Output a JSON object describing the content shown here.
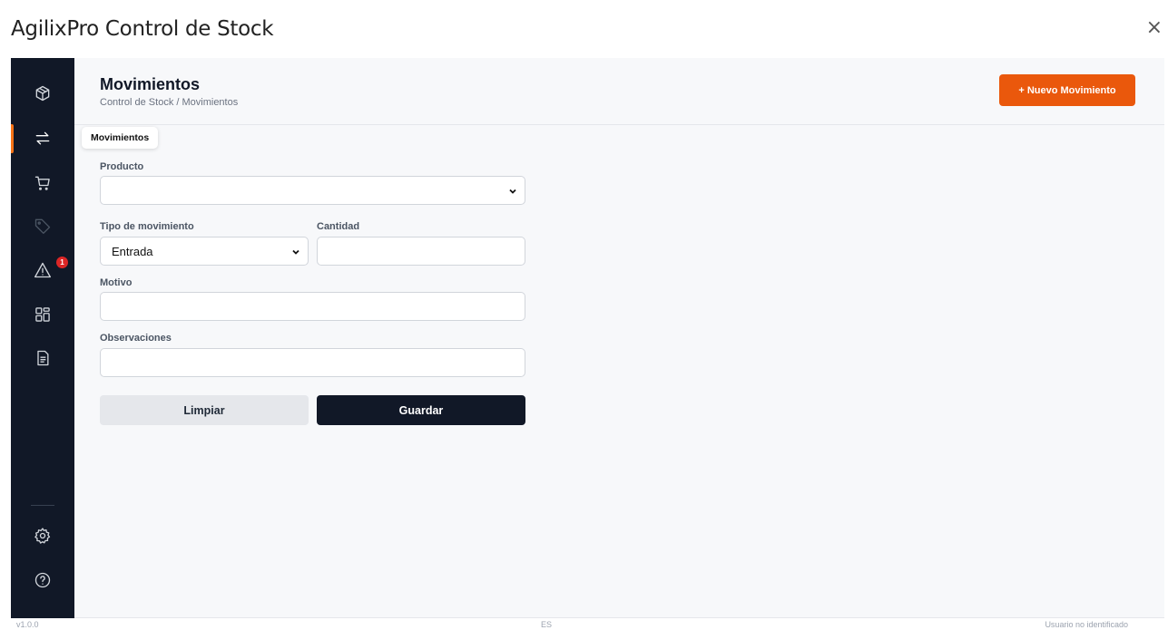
{
  "window": {
    "title": "AgilixPro Control de Stock",
    "close_glyph": "×"
  },
  "sidebar": {
    "items": [
      {
        "icon": "box-icon",
        "name": "products",
        "active": false
      },
      {
        "icon": "transfer-icon",
        "name": "movements",
        "active": true
      },
      {
        "icon": "cart-icon",
        "name": "purchases",
        "active": false
      },
      {
        "icon": "tag-icon",
        "name": "prices",
        "active": false
      },
      {
        "icon": "warning-icon",
        "name": "alerts",
        "active": false,
        "badge": "1"
      },
      {
        "icon": "dashboard-icon",
        "name": "dashboard",
        "active": false
      },
      {
        "icon": "report-icon",
        "name": "reports",
        "active": false
      },
      {
        "icon": "gear-icon",
        "name": "settings",
        "active": false
      },
      {
        "icon": "help-icon",
        "name": "help",
        "active": false
      }
    ],
    "tooltip": "Movimientos"
  },
  "header": {
    "title": "Movimientos",
    "breadcrumb": "Control de Stock / Movimientos",
    "new_button": "+ Nuevo Movimiento"
  },
  "form": {
    "producto_label": "Producto",
    "producto_value": "",
    "tipo_label": "Tipo de movimiento",
    "tipo_value": "Entrada",
    "cantidad_label": "Cantidad",
    "cantidad_value": "",
    "motivo_label": "Motivo",
    "motivo_value": "",
    "observaciones_label": "Observaciones",
    "observaciones_value": "",
    "clear_button": "Limpiar",
    "save_button": "Guardar"
  },
  "footer": {
    "left": "v1.0.0",
    "center": "ES",
    "right": "Usuario no identificado"
  },
  "colors": {
    "sidebar": "#111827",
    "accent": "#ea580c",
    "save": "#111827",
    "badge": "#dc2626"
  }
}
